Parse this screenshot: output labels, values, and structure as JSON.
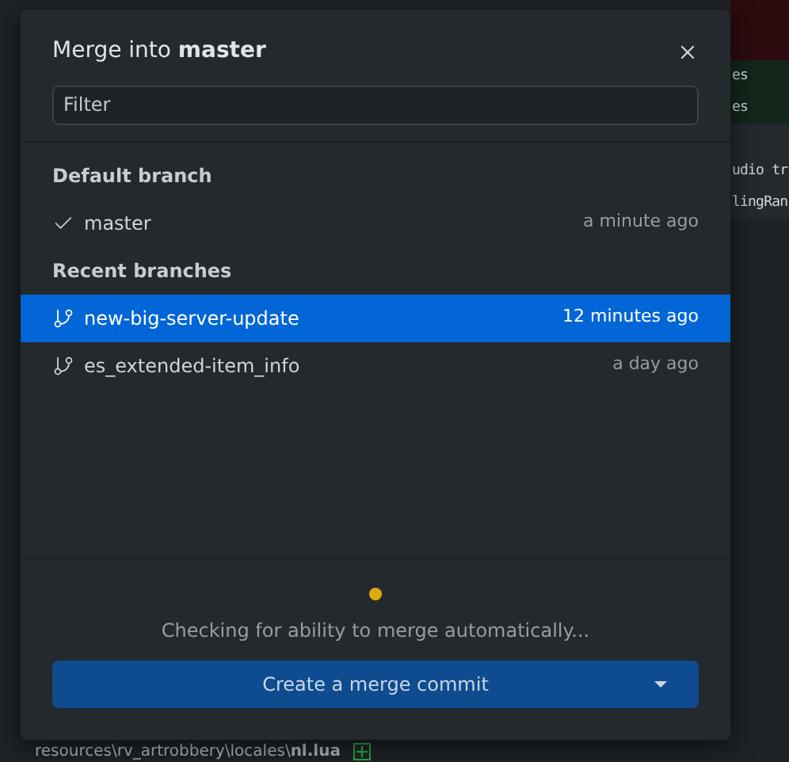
{
  "background": {
    "diff_lines": [
      {
        "kind": "deleted"
      },
      {
        "kind": "added",
        "text": "es"
      },
      {
        "kind": "added",
        "text": "es"
      },
      {
        "kind": "context"
      },
      {
        "kind": "context",
        "text": "udio tr"
      },
      {
        "kind": "context",
        "text": "lingRan"
      }
    ],
    "file_path": "resources\\rv_artrobbery\\locales\\**nl.lua**"
  },
  "dialog": {
    "title": "Merge into **master**",
    "filter": {
      "placeholder": "Filter"
    },
    "sections": [
      {
        "heading": "Default branch",
        "branches": [
          {
            "name": "master",
            "time": "a minute ago",
            "kind": "default",
            "selected": false
          }
        ]
      },
      {
        "heading": "Recent branches",
        "branches": [
          {
            "name": "new-big-server-update",
            "time": "12 minutes ago",
            "kind": "branch",
            "selected": true
          },
          {
            "name": "es_extended-item_info",
            "time": "a day ago",
            "kind": "branch",
            "selected": false
          }
        ]
      }
    ],
    "status": "Checking for ability to merge automatically...",
    "merge_button": "Create a merge commit"
  }
}
